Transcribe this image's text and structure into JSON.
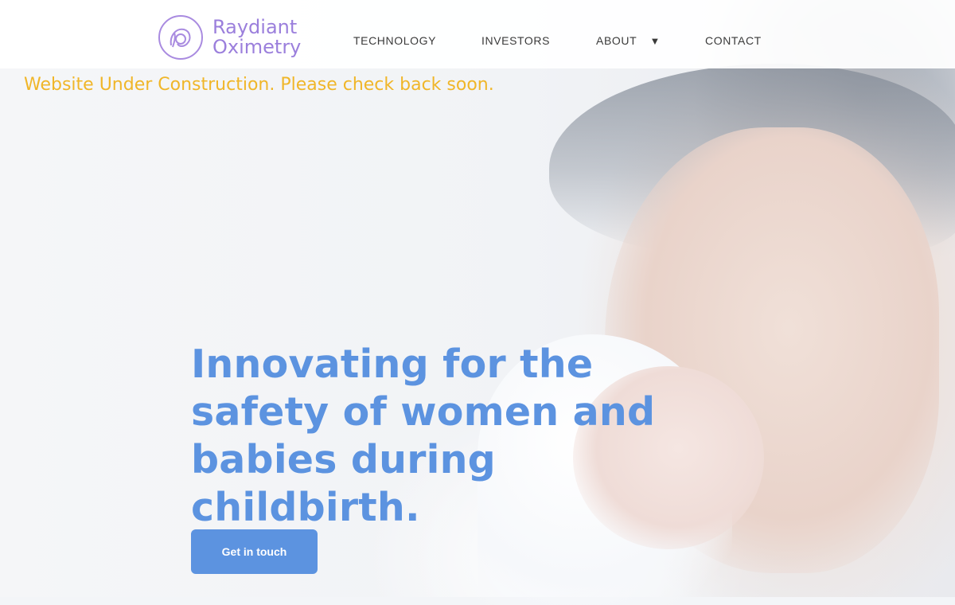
{
  "header": {
    "logo": {
      "line1": "Raydiant",
      "line2": "Oximetry"
    },
    "nav": [
      {
        "label": "TECHNOLOGY"
      },
      {
        "label": "INVESTORS"
      },
      {
        "label": "ABOUT",
        "caret": "▼"
      },
      {
        "label": "CONTACT"
      }
    ]
  },
  "notice": "Website Under Construction. Please check back soon.",
  "hero": {
    "headline": "Innovating for the safety of women and babies during childbirth.",
    "cta_label": "Get in touch"
  },
  "colors": {
    "brand_purple": "#9b7fdc",
    "accent_blue": "#5c93e0",
    "notice_yellow": "#f0b629"
  }
}
